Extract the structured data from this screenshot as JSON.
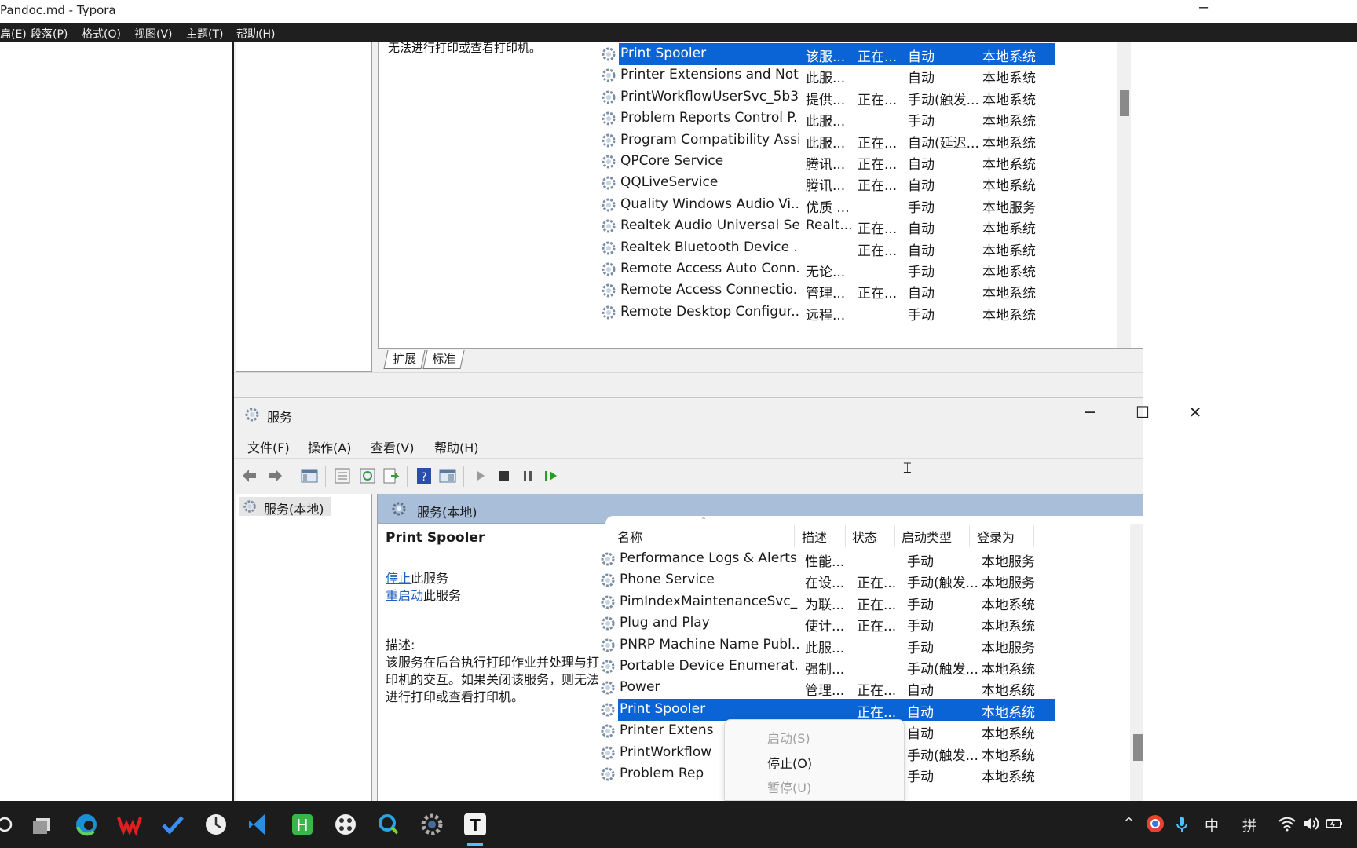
{
  "typora": {
    "title": "Pandoc.md - Typora",
    "minimize_glyph": "─",
    "menu": [
      "扁(E)",
      "段落(P)",
      "格式(O)",
      "视图(V)",
      "主题(T)",
      "帮助(H)"
    ]
  },
  "top_window": {
    "desc_fragment": "无法进行打印或查看打印机。",
    "tabs": [
      "扩展",
      "标准"
    ],
    "rows": [
      {
        "name": "Print Spooler",
        "desc": "该服...",
        "status": "正在...",
        "startup": "自动",
        "logon": "本地系统",
        "selected": true
      },
      {
        "name": "Printer Extensions and Noti...",
        "desc": "此服...",
        "status": "",
        "startup": "自动",
        "logon": "本地系统"
      },
      {
        "name": "PrintWorkflowUserSvc_5b3...",
        "desc": "提供...",
        "status": "正在...",
        "startup": "手动(触发...",
        "logon": "本地系统"
      },
      {
        "name": "Problem Reports Control P...",
        "desc": "此服...",
        "status": "",
        "startup": "手动",
        "logon": "本地系统"
      },
      {
        "name": "Program Compatibility Assi...",
        "desc": "此服...",
        "status": "正在...",
        "startup": "自动(延迟...",
        "logon": "本地系统"
      },
      {
        "name": "QPCore Service",
        "desc": "腾讯...",
        "status": "正在...",
        "startup": "自动",
        "logon": "本地系统"
      },
      {
        "name": "QQLiveService",
        "desc": "腾讯...",
        "status": "正在...",
        "startup": "自动",
        "logon": "本地系统"
      },
      {
        "name": "Quality Windows Audio Vi...",
        "desc": "优质 ...",
        "status": "",
        "startup": "手动",
        "logon": "本地服务"
      },
      {
        "name": "Realtek Audio Universal Se...",
        "desc": "Realt...",
        "status": "正在...",
        "startup": "自动",
        "logon": "本地系统"
      },
      {
        "name": "Realtek Bluetooth Device ...",
        "desc": "",
        "status": "正在...",
        "startup": "自动",
        "logon": "本地系统"
      },
      {
        "name": "Remote Access Auto Conn...",
        "desc": "无论...",
        "status": "",
        "startup": "手动",
        "logon": "本地系统"
      },
      {
        "name": "Remote Access Connectio...",
        "desc": "管理...",
        "status": "正在...",
        "startup": "自动",
        "logon": "本地系统"
      },
      {
        "name": "Remote Desktop Configur...",
        "desc": "远程...",
        "status": "",
        "startup": "手动",
        "logon": "本地系统"
      }
    ]
  },
  "main_window": {
    "title": "服务",
    "buttons": {
      "minimize": "─",
      "maximize": "☐",
      "close": "✕"
    },
    "menu": [
      "文件(F)",
      "操作(A)",
      "查看(V)",
      "帮助(H)"
    ],
    "tree_node": "服务(本地)",
    "panel_header": "服务(本地)",
    "service_title": "Print Spooler",
    "stop_link": "停止",
    "stop_suffix": "此服务",
    "restart_link": "重启动",
    "restart_suffix": "此服务",
    "desc_label": "描述:",
    "desc_text": "该服务在后台执行打印作业并处理与打印机的交互。如果关闭该服务，则无法进行打印或查看打印机。",
    "columns": [
      "名称",
      "描述",
      "状态",
      "启动类型",
      "登录为"
    ],
    "sort_glyph": "˄",
    "rows": [
      {
        "name": "Performance Logs & Alerts",
        "desc": "性能...",
        "status": "",
        "startup": "手动",
        "logon": "本地服务"
      },
      {
        "name": "Phone Service",
        "desc": "在设...",
        "status": "正在...",
        "startup": "手动(触发...",
        "logon": "本地服务"
      },
      {
        "name": "PimIndexMaintenanceSvc_...",
        "desc": "为联...",
        "status": "正在...",
        "startup": "手动",
        "logon": "本地系统"
      },
      {
        "name": "Plug and Play",
        "desc": "使计...",
        "status": "正在...",
        "startup": "手动",
        "logon": "本地系统"
      },
      {
        "name": "PNRP Machine Name Publ...",
        "desc": "此服...",
        "status": "",
        "startup": "手动",
        "logon": "本地服务"
      },
      {
        "name": "Portable Device Enumerat...",
        "desc": "强制...",
        "status": "",
        "startup": "手动(触发...",
        "logon": "本地系统"
      },
      {
        "name": "Power",
        "desc": "管理...",
        "status": "正在...",
        "startup": "自动",
        "logon": "本地系统"
      },
      {
        "name": "Print Spooler",
        "desc": "",
        "status": "正在...",
        "startup": "自动",
        "logon": "本地系统",
        "selected": true
      },
      {
        "name": "Printer Extens",
        "desc": "",
        "status": "",
        "startup": "自动",
        "logon": "本地系统"
      },
      {
        "name": "PrintWorkflow",
        "desc": "",
        "status": "正在...",
        "startup": "手动(触发...",
        "logon": "本地系统"
      },
      {
        "name": "Problem Rep",
        "desc": "",
        "status": "",
        "startup": "手动",
        "logon": "本地系统"
      }
    ]
  },
  "context_menu": {
    "items": [
      {
        "label": "启动(S)",
        "enabled": false
      },
      {
        "label": "停止(O)",
        "enabled": true
      },
      {
        "label": "暂停(U)",
        "enabled": false
      }
    ]
  },
  "taskbar": {
    "apps": [
      "search-icon",
      "task-view-icon",
      "edge-icon",
      "wps-icon",
      "todo-icon",
      "clock-icon",
      "vscode-icon",
      "h-app-icon",
      "app-icon",
      "search-app-icon",
      "settings-icon",
      "typora-icon"
    ],
    "tray_ime_1": "中",
    "tray_ime_2": "拼",
    "chevron": "^"
  },
  "colors": {
    "accent": "#0a64d6",
    "panel_header": "#a9bfd9",
    "taskbar": "#1c1c1c"
  }
}
